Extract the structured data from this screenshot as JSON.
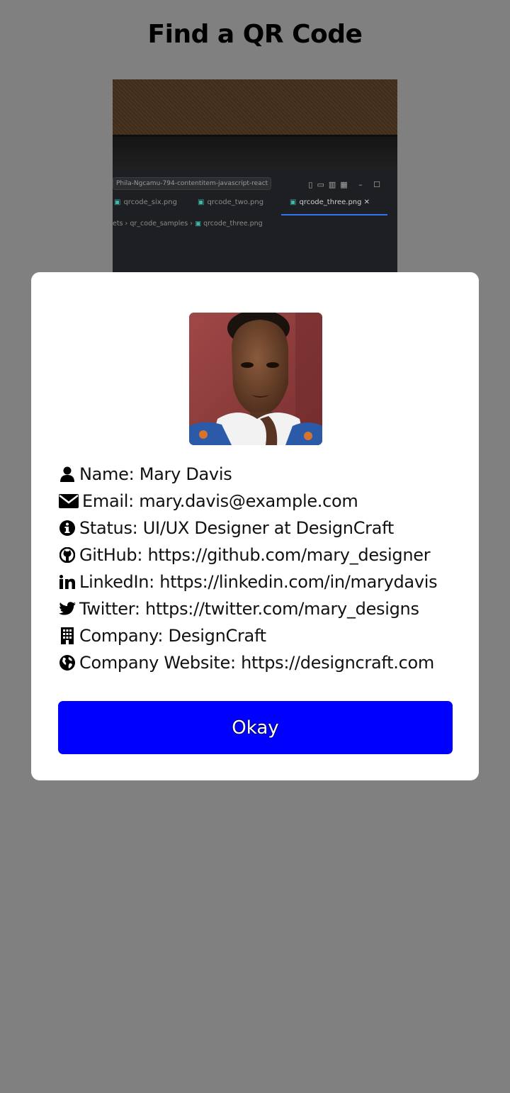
{
  "page": {
    "title": "Find a QR Code"
  },
  "camera": {
    "branch": "Phila-Ngcamu-794-contentitem-javascript-react",
    "tabs": [
      {
        "label": "qrcode_six.png"
      },
      {
        "label": "qrcode_two.png"
      },
      {
        "label": "qrcode_three.png"
      }
    ],
    "tab_close": "✕",
    "breadcrumb_prefix": "ets",
    "breadcrumb_folder": "qr_code_samples",
    "breadcrumb_file": "qrcode_three.png"
  },
  "profile": {
    "rows": [
      {
        "icon": "user-icon",
        "text": "Name: Mary Davis"
      },
      {
        "icon": "envelope-icon",
        "text": "Email: mary.davis@example.com"
      },
      {
        "icon": "info-circle-icon",
        "text": "Status: UI/UX Designer at DesignCraft"
      },
      {
        "icon": "github-icon",
        "text": "GitHub: https://github.com/mary_designer"
      },
      {
        "icon": "linkedin-icon",
        "text": "LinkedIn: https://linkedin.com/in/marydavis"
      },
      {
        "icon": "twitter-icon",
        "text": "Twitter: https://twitter.com/mary_designs"
      },
      {
        "icon": "building-icon",
        "text": "Company: DesignCraft"
      },
      {
        "icon": "globe-icon",
        "text": "Company Website: https://designcraft.com"
      }
    ],
    "button_label": "Okay"
  },
  "colors": {
    "overlay": "#808080",
    "modal": "#ffffff",
    "button": "#0000ff",
    "button_text": "#ffffff"
  }
}
